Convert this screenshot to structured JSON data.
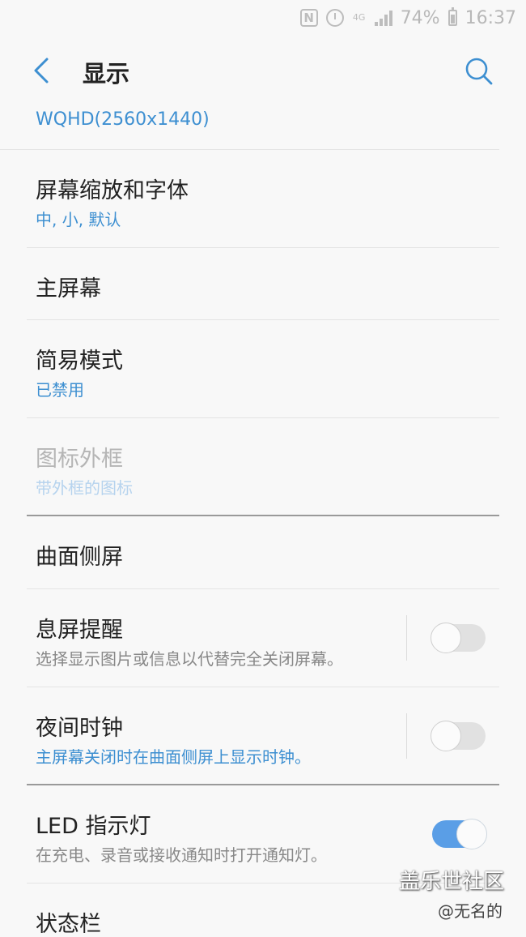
{
  "status_bar": {
    "nfc_icon": "N",
    "network_type": "4G",
    "battery_percent": "74%",
    "time": "16:37"
  },
  "header": {
    "title": "显示"
  },
  "resolution": "WQHD(2560x1440)",
  "items": [
    {
      "title": "屏幕缩放和字体",
      "subtitle": "中, 小, 默认"
    },
    {
      "title": "主屏幕"
    },
    {
      "title": "简易模式",
      "subtitle": "已禁用"
    },
    {
      "title": "图标外框",
      "subtitle": "带外框的图标"
    },
    {
      "title": "曲面侧屏"
    },
    {
      "title": "息屏提醒",
      "subtitle": "选择显示图片或信息以代替完全关闭屏幕。",
      "toggle": false
    },
    {
      "title": "夜间时钟",
      "subtitle": "主屏幕关闭时在曲面侧屏上显示时钟。",
      "toggle": false
    },
    {
      "title": "LED 指示灯",
      "subtitle": "在充电、录音或接收通知时打开通知灯。",
      "toggle": true
    },
    {
      "title": "状态栏"
    }
  ],
  "watermark": {
    "main": "盖乐世社区",
    "sub": "@无名的"
  },
  "colors": {
    "accent": "#3d8fd1",
    "switch_on": "#5a9ee6",
    "background": "#f8f8f8"
  }
}
